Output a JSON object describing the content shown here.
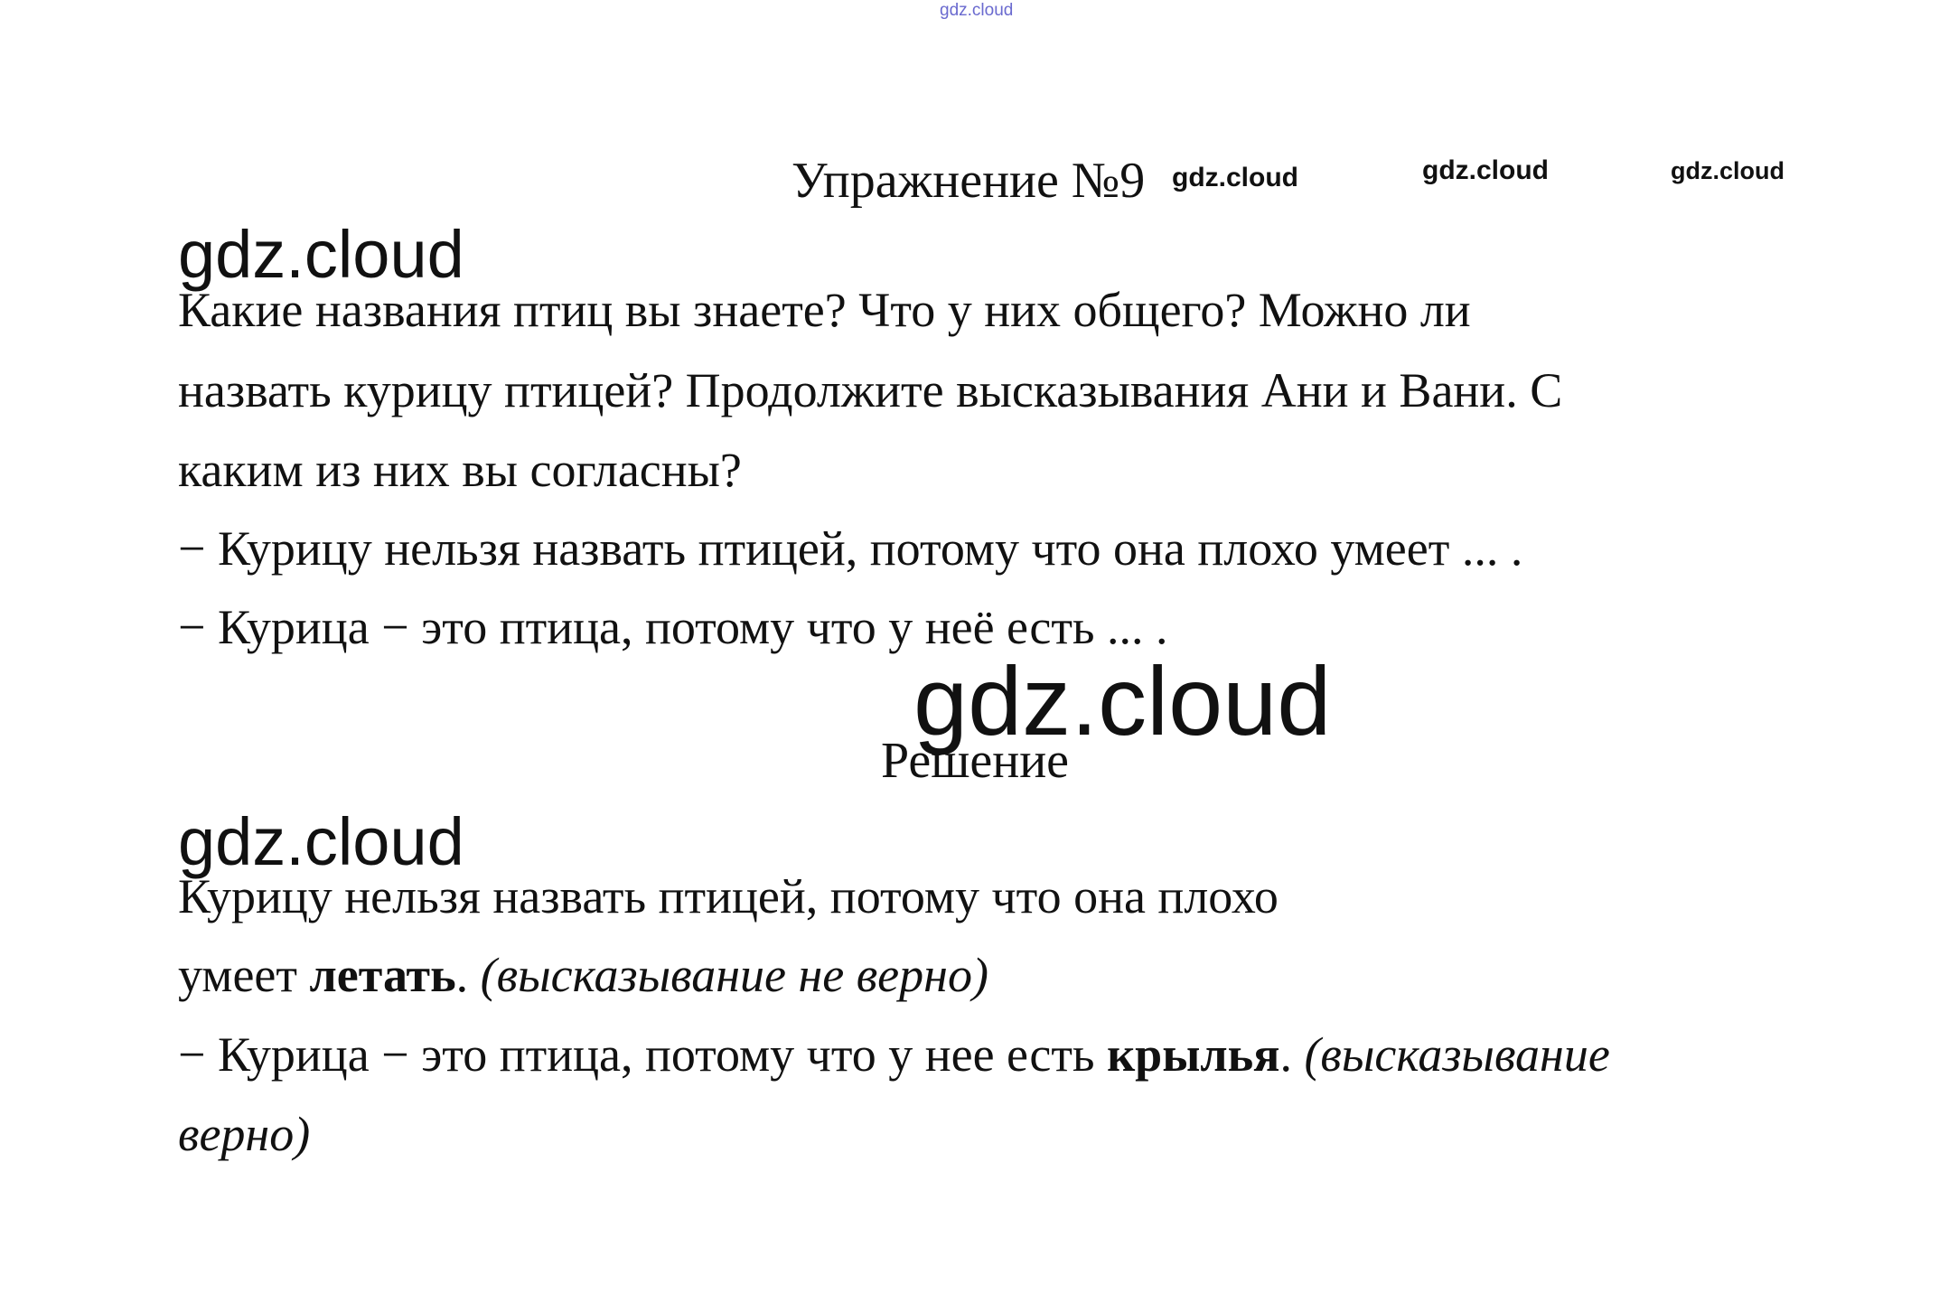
{
  "watermarks": {
    "top": "gdz.cloud",
    "header_1": "gdz.cloud",
    "header_2": "gdz.cloud",
    "header_3": "gdz.cloud",
    "body_1": "gdz.cloud",
    "center": "gdz.cloud",
    "body_2": "gdz.cloud"
  },
  "exercise": {
    "title": "Упражнение №9",
    "lines": [
      "Какие названия птиц вы знаете? Что у них общего? Можно ли",
      "назвать курицу птицей? Продолжите высказывания Ани и Вани. С",
      "каким из них вы согласны?",
      "− Курицу нельзя назвать птицей, потому что она плохо умеет ... .",
      "− Курица − это птица, потому что у неё есть ... ."
    ]
  },
  "solution": {
    "title": "Решение",
    "line1": "Курицу нельзя назвать птицей, потому что она плохо",
    "line2": {
      "prefix": "умеет ",
      "bold": "летать",
      "punct": ". ",
      "note": "(высказывание не верно)"
    },
    "line3": {
      "prefix": "− Курица − это птица, потому что у нее есть ",
      "bold": "крылья",
      "punct": ". ",
      "note": "(высказывание"
    },
    "line4": "верно)"
  }
}
